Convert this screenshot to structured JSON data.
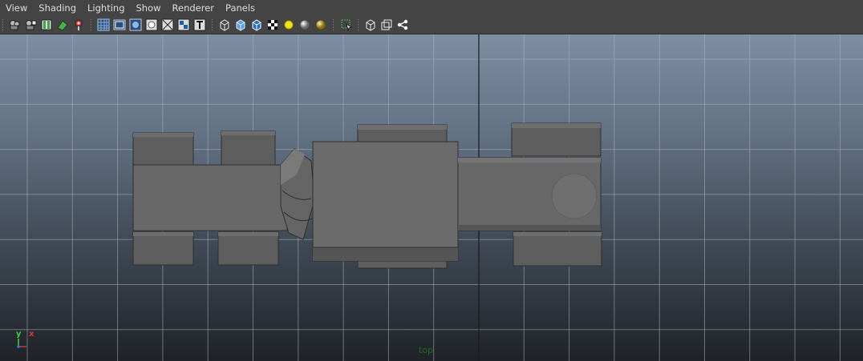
{
  "menu": {
    "items": [
      {
        "id": "view",
        "label": "View"
      },
      {
        "id": "shading",
        "label": "Shading"
      },
      {
        "id": "lighting",
        "label": "Lighting"
      },
      {
        "id": "show",
        "label": "Show"
      },
      {
        "id": "renderer",
        "label": "Renderer"
      },
      {
        "id": "panels",
        "label": "Panels"
      }
    ]
  },
  "toolbar": {
    "icons": [
      "select-camera-icon",
      "camera-attributes-icon",
      "bookmarks-icon",
      "image-plane-icon",
      "2d-pan-zoom-icon",
      "grid-icon",
      "film-gate-icon",
      "resolution-gate-icon",
      "gate-mask-icon",
      "field-chart-icon",
      "safe-action-icon",
      "safe-title-icon",
      "wireframe-icon",
      "smooth-shade-icon",
      "wireframe-on-shaded-icon",
      "textured-icon",
      "use-all-lights-icon",
      "shadows-icon",
      "screen-space-ao-icon",
      "isolate-select-icon",
      "xray-icon",
      "xray-active-components-icon",
      "xray-joints-icon"
    ]
  },
  "viewport": {
    "camera_label": "top",
    "axis": {
      "x": "x",
      "y": "y"
    },
    "colors": {
      "grid": "#a9b0b8",
      "model_fill": "#6a6a6a",
      "model_edge": "#303030",
      "axis_x": "#d23a3a",
      "axis_y": "#3fcf3f",
      "label": "#1d6b2a"
    }
  }
}
